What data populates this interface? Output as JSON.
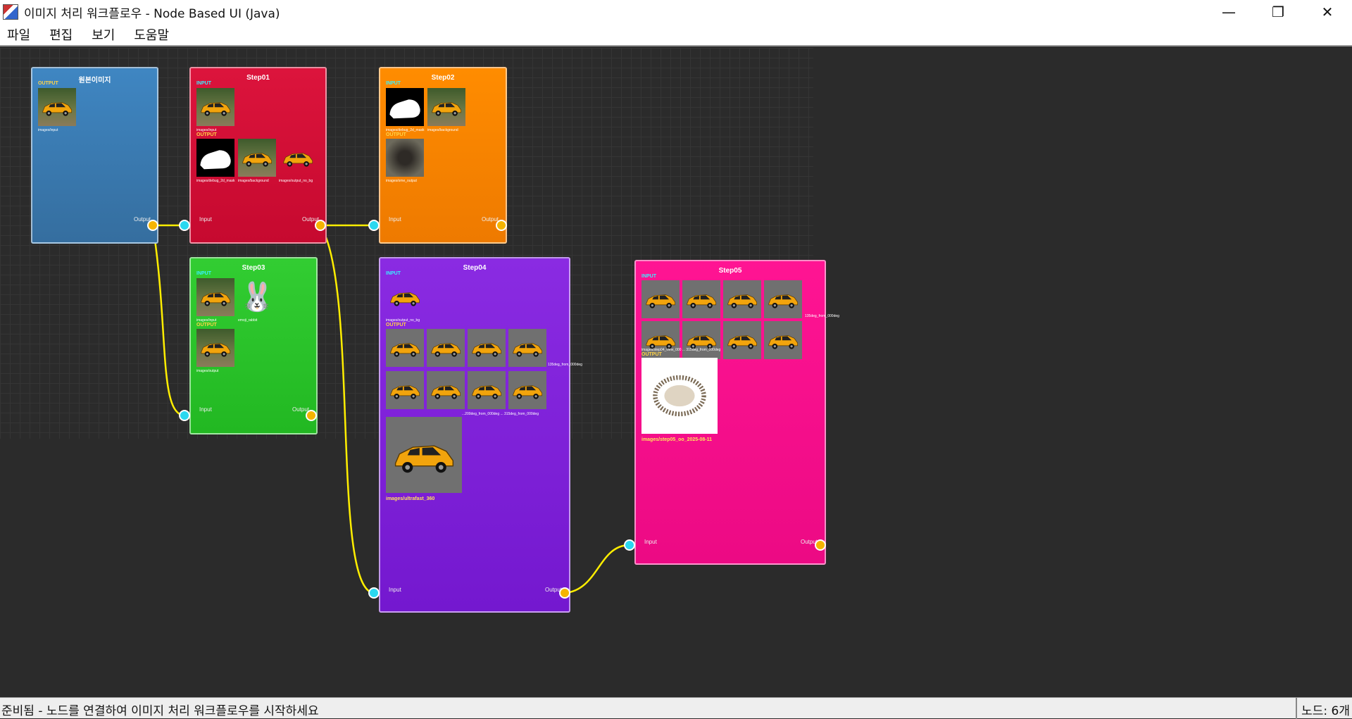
{
  "window": {
    "title": "이미지 처리 워크플로우 - Node Based UI (Java)"
  },
  "menu": [
    "파일",
    "편집",
    "보기",
    "도움말"
  ],
  "colors": {
    "node_source": "#3b7bb5",
    "step01": "#d01238",
    "step02": "#f38a06",
    "step03": "#2ccc33",
    "step04": "#8a1fe0",
    "step05": "#f01591",
    "wire": "#ffee00",
    "port_in": "#2ad8f0",
    "port_out": "#f5b400"
  },
  "nodes": {
    "source": {
      "title": "원본이미지",
      "output_label": "OUTPUT",
      "cap": "images/input",
      "port_out": "Output"
    },
    "step01": {
      "title": "Step01",
      "input_label": "INPUT",
      "output_label": "OUTPUT",
      "cap_in": "images/input",
      "caps_out": [
        "images/debug_2d_mask",
        "images/background",
        "images/output_no_bg"
      ],
      "port_in": "Input",
      "port_out": "Output"
    },
    "step02": {
      "title": "Step02",
      "input_label": "INPUT",
      "output_label": "OUTPUT",
      "caps_in": [
        "images/debug_2d_mask",
        "images/background"
      ],
      "cap_out": "images/ome_output",
      "port_in": "Input",
      "port_out": "Output"
    },
    "step03": {
      "title": "Step03",
      "input_label": "INPUT",
      "output_label": "OUTPUT",
      "caps_in": [
        "images/input",
        "emoji_rabbit"
      ],
      "cap_out": "images/output",
      "emoji": "🐰",
      "port_in": "Input",
      "port_out": "Output"
    },
    "step04": {
      "title": "Step04",
      "input_label": "INPUT",
      "output_label": "OUTPUT",
      "cap_in": "images/output_no_bg",
      "cap_row1": "135deg_from_000deg",
      "cap_row2": "...200deg_from_000deg ... 315deg_from_000deg",
      "cap_big": "images/ultrafast_360",
      "port_in": "Input",
      "port_out": "Output"
    },
    "step05": {
      "title": "Step05",
      "input_label": "INPUT",
      "output_label": "OUTPUT",
      "cap_row1": "135deg_from_000deg",
      "cap_row2": "images/step04_view_000 ... 315deg_from_000deg",
      "cap_big": "images/step05_oo_2025-08-11",
      "port_in": "Input",
      "port_out": "Output"
    }
  },
  "status": {
    "message": "준비됨 - 노드를 연결하여 이미지 처리 워크플로우를 시작하세요",
    "count": "노드: 6개"
  }
}
